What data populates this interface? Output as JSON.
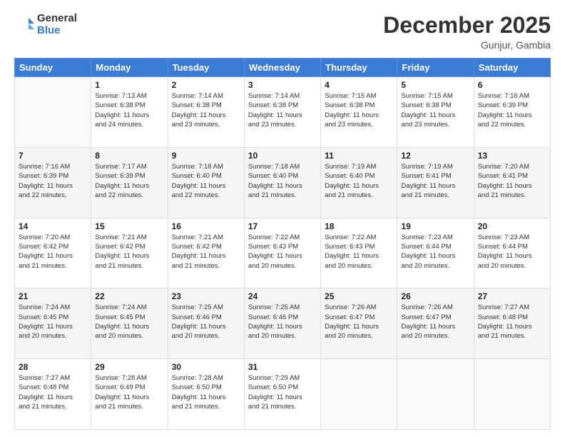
{
  "header": {
    "logo_general": "General",
    "logo_blue": "Blue",
    "month_year": "December 2025",
    "location": "Gunjur, Gambia"
  },
  "days_of_week": [
    "Sunday",
    "Monday",
    "Tuesday",
    "Wednesday",
    "Thursday",
    "Friday",
    "Saturday"
  ],
  "weeks": [
    [
      {
        "day": "",
        "info": ""
      },
      {
        "day": "1",
        "info": "Sunrise: 7:13 AM\nSunset: 6:38 PM\nDaylight: 11 hours\nand 24 minutes."
      },
      {
        "day": "2",
        "info": "Sunrise: 7:14 AM\nSunset: 6:38 PM\nDaylight: 11 hours\nand 23 minutes."
      },
      {
        "day": "3",
        "info": "Sunrise: 7:14 AM\nSunset: 6:38 PM\nDaylight: 11 hours\nand 23 minutes."
      },
      {
        "day": "4",
        "info": "Sunrise: 7:15 AM\nSunset: 6:38 PM\nDaylight: 11 hours\nand 23 minutes."
      },
      {
        "day": "5",
        "info": "Sunrise: 7:15 AM\nSunset: 6:38 PM\nDaylight: 11 hours\nand 23 minutes."
      },
      {
        "day": "6",
        "info": "Sunrise: 7:16 AM\nSunset: 6:39 PM\nDaylight: 11 hours\nand 22 minutes."
      }
    ],
    [
      {
        "day": "7",
        "info": "Sunrise: 7:16 AM\nSunset: 6:39 PM\nDaylight: 11 hours\nand 22 minutes."
      },
      {
        "day": "8",
        "info": "Sunrise: 7:17 AM\nSunset: 6:39 PM\nDaylight: 11 hours\nand 22 minutes."
      },
      {
        "day": "9",
        "info": "Sunrise: 7:18 AM\nSunset: 6:40 PM\nDaylight: 11 hours\nand 22 minutes."
      },
      {
        "day": "10",
        "info": "Sunrise: 7:18 AM\nSunset: 6:40 PM\nDaylight: 11 hours\nand 21 minutes."
      },
      {
        "day": "11",
        "info": "Sunrise: 7:19 AM\nSunset: 6:40 PM\nDaylight: 11 hours\nand 21 minutes."
      },
      {
        "day": "12",
        "info": "Sunrise: 7:19 AM\nSunset: 6:41 PM\nDaylight: 11 hours\nand 21 minutes."
      },
      {
        "day": "13",
        "info": "Sunrise: 7:20 AM\nSunset: 6:41 PM\nDaylight: 11 hours\nand 21 minutes."
      }
    ],
    [
      {
        "day": "14",
        "info": "Sunrise: 7:20 AM\nSunset: 6:42 PM\nDaylight: 11 hours\nand 21 minutes."
      },
      {
        "day": "15",
        "info": "Sunrise: 7:21 AM\nSunset: 6:42 PM\nDaylight: 11 hours\nand 21 minutes."
      },
      {
        "day": "16",
        "info": "Sunrise: 7:21 AM\nSunset: 6:42 PM\nDaylight: 11 hours\nand 21 minutes."
      },
      {
        "day": "17",
        "info": "Sunrise: 7:22 AM\nSunset: 6:43 PM\nDaylight: 11 hours\nand 20 minutes."
      },
      {
        "day": "18",
        "info": "Sunrise: 7:22 AM\nSunset: 6:43 PM\nDaylight: 11 hours\nand 20 minutes."
      },
      {
        "day": "19",
        "info": "Sunrise: 7:23 AM\nSunset: 6:44 PM\nDaylight: 11 hours\nand 20 minutes."
      },
      {
        "day": "20",
        "info": "Sunrise: 7:23 AM\nSunset: 6:44 PM\nDaylight: 11 hours\nand 20 minutes."
      }
    ],
    [
      {
        "day": "21",
        "info": "Sunrise: 7:24 AM\nSunset: 6:45 PM\nDaylight: 11 hours\nand 20 minutes."
      },
      {
        "day": "22",
        "info": "Sunrise: 7:24 AM\nSunset: 6:45 PM\nDaylight: 11 hours\nand 20 minutes."
      },
      {
        "day": "23",
        "info": "Sunrise: 7:25 AM\nSunset: 6:46 PM\nDaylight: 11 hours\nand 20 minutes."
      },
      {
        "day": "24",
        "info": "Sunrise: 7:25 AM\nSunset: 6:46 PM\nDaylight: 11 hours\nand 20 minutes."
      },
      {
        "day": "25",
        "info": "Sunrise: 7:26 AM\nSunset: 6:47 PM\nDaylight: 11 hours\nand 20 minutes."
      },
      {
        "day": "26",
        "info": "Sunrise: 7:26 AM\nSunset: 6:47 PM\nDaylight: 11 hours\nand 20 minutes."
      },
      {
        "day": "27",
        "info": "Sunrise: 7:27 AM\nSunset: 6:48 PM\nDaylight: 11 hours\nand 21 minutes."
      }
    ],
    [
      {
        "day": "28",
        "info": "Sunrise: 7:27 AM\nSunset: 6:48 PM\nDaylight: 11 hours\nand 21 minutes."
      },
      {
        "day": "29",
        "info": "Sunrise: 7:28 AM\nSunset: 6:49 PM\nDaylight: 11 hours\nand 21 minutes."
      },
      {
        "day": "30",
        "info": "Sunrise: 7:28 AM\nSunset: 6:50 PM\nDaylight: 11 hours\nand 21 minutes."
      },
      {
        "day": "31",
        "info": "Sunrise: 7:29 AM\nSunset: 6:50 PM\nDaylight: 11 hours\nand 21 minutes."
      },
      {
        "day": "",
        "info": ""
      },
      {
        "day": "",
        "info": ""
      },
      {
        "day": "",
        "info": ""
      }
    ]
  ]
}
